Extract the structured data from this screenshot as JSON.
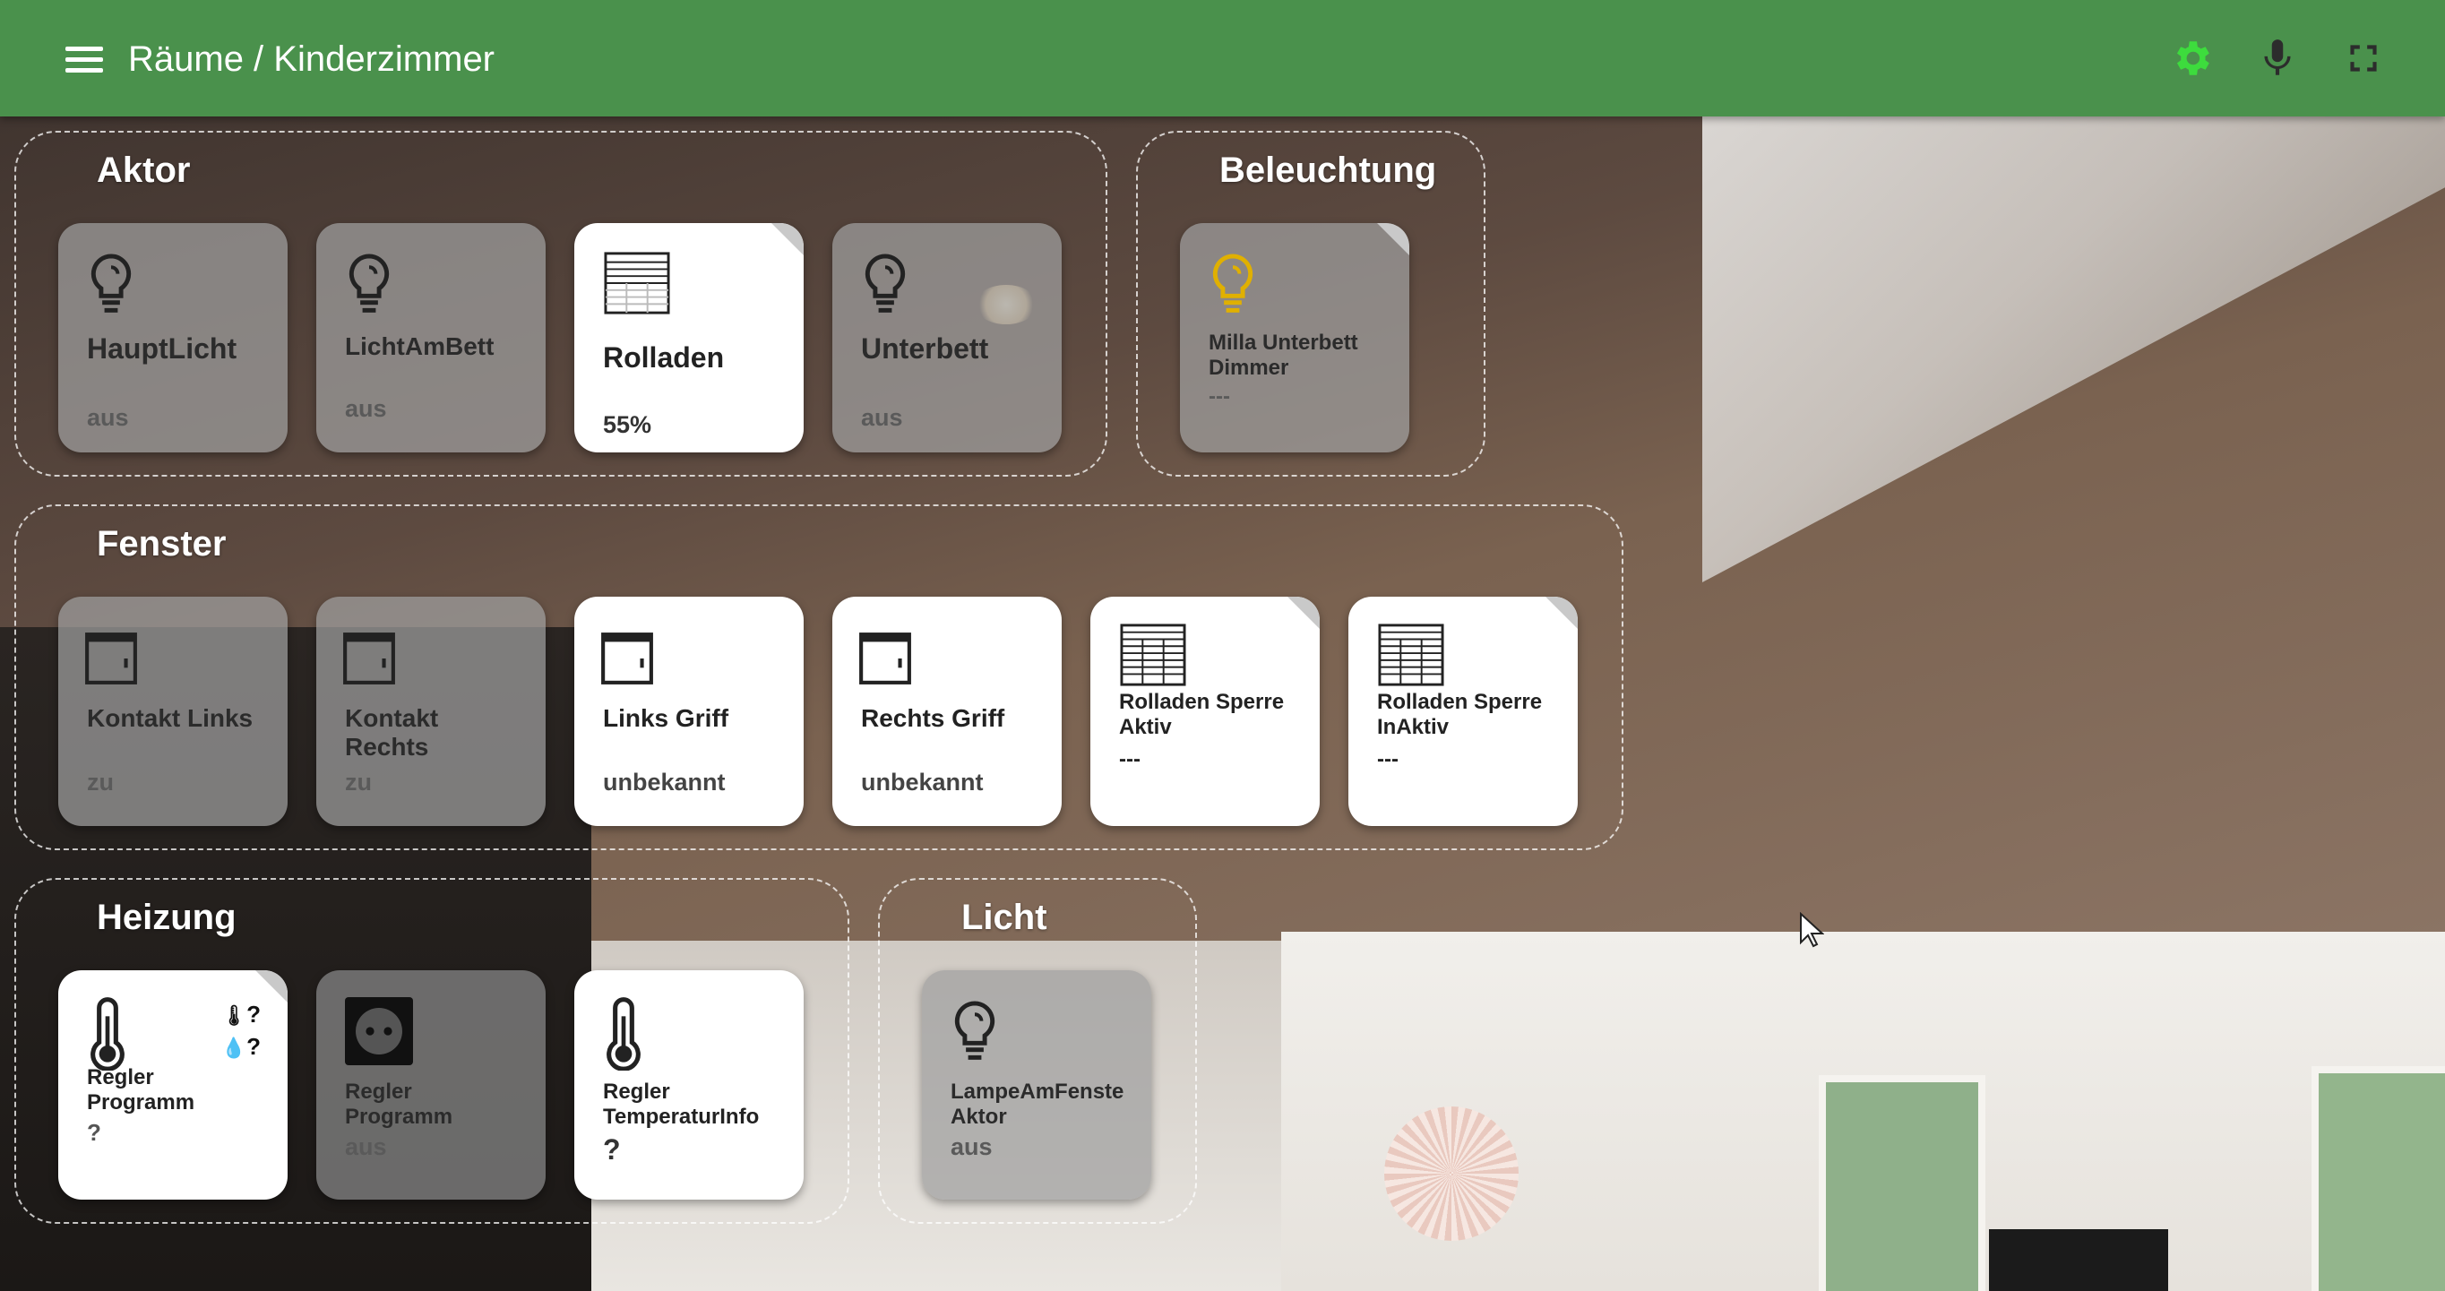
{
  "header": {
    "title": "Räume / Kinderzimmer",
    "icons": [
      "menu-icon",
      "gear-icon",
      "microphone-icon",
      "fullscreen-icon"
    ],
    "accent": "#4a914c",
    "gear_color": "#3ddc3d"
  },
  "groups": {
    "aktor": {
      "title": "Aktor",
      "tiles": [
        {
          "name": "HauptLicht",
          "state": "aus",
          "icon": "lightbulb-icon",
          "active": false
        },
        {
          "name": "LichtAmBett",
          "state": "aus",
          "icon": "lightbulb-icon",
          "active": false
        },
        {
          "name": "Rolladen",
          "state": "55%",
          "icon": "blinds-icon",
          "active": true
        },
        {
          "name": "Unterbett",
          "state": "aus",
          "icon": "lightbulb-icon",
          "active": false
        }
      ]
    },
    "beleuchtung": {
      "title": "Beleuchtung",
      "tiles": [
        {
          "name": "Milla Unterbett Dimmer",
          "state": "---",
          "icon": "lightbulb-icon",
          "icon_color": "#e0b000",
          "active": false
        }
      ]
    },
    "fenster": {
      "title": "Fenster",
      "tiles": [
        {
          "name": "Kontakt Links",
          "state": "zu",
          "icon": "window-icon",
          "active": false
        },
        {
          "name": "Kontakt Rechts",
          "state": "zu",
          "icon": "window-icon",
          "active": false
        },
        {
          "name": "Links Griff",
          "state": "unbekannt",
          "icon": "window-icon",
          "active": true
        },
        {
          "name": "Rechts Griff",
          "state": "unbekannt",
          "icon": "window-icon",
          "active": true
        },
        {
          "name": "Rolladen Sperre Aktiv",
          "state": "---",
          "icon": "blinds-icon",
          "active": true
        },
        {
          "name": "Rolladen Sperre InAktiv",
          "state": "---",
          "icon": "blinds-icon",
          "active": true
        }
      ]
    },
    "heizung": {
      "title": "Heizung",
      "tiles": [
        {
          "name": "Regler Programm",
          "state": "?",
          "icon": "thermometer-icon",
          "active": true,
          "temp": "?",
          "humidity": "?"
        },
        {
          "name": "Regler Programm",
          "state": "aus",
          "icon": "socket-icon",
          "active": false
        },
        {
          "name": "Regler TemperaturInfo",
          "state": "?",
          "icon": "thermometer-icon",
          "active": true
        }
      ]
    },
    "licht": {
      "title": "Licht",
      "tiles": [
        {
          "name": "LampeAmFenste Aktor",
          "state": "aus",
          "icon": "lightbulb-icon",
          "active": false
        }
      ]
    }
  }
}
